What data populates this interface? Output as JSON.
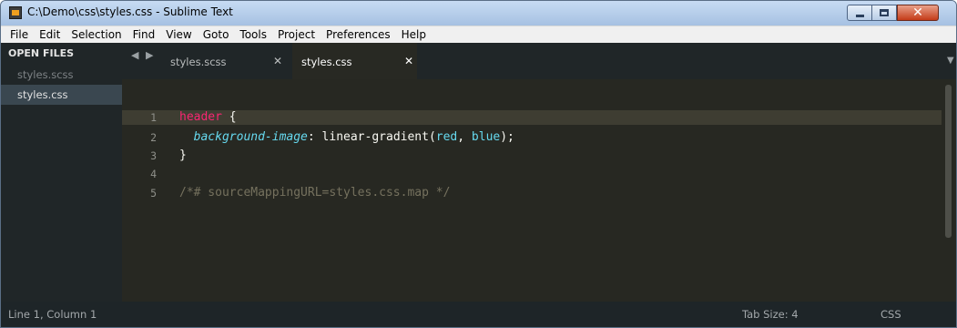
{
  "window": {
    "title": "C:\\Demo\\css\\styles.css - Sublime Text",
    "icons": {
      "app": "sublime-text-icon",
      "minimize": "minimize-icon",
      "maximize": "maximize-icon",
      "close": "close-icon"
    },
    "close_glyph": "✕"
  },
  "menu": {
    "items": [
      "File",
      "Edit",
      "Selection",
      "Find",
      "View",
      "Goto",
      "Tools",
      "Project",
      "Preferences",
      "Help"
    ]
  },
  "sidebar": {
    "heading": "OPEN FILES",
    "files": [
      "styles.scss",
      "styles.css"
    ],
    "selected": "styles.css"
  },
  "tabs": {
    "nav_arrows": "◀ ▶",
    "items": [
      {
        "label": "styles.scss",
        "close": "✕"
      },
      {
        "label": "styles.css",
        "close": "✕"
      }
    ],
    "active": "styles.css",
    "overflow_glyph": "▼"
  },
  "editor": {
    "line_numbers": [
      "1",
      "2",
      "3",
      "4",
      "5"
    ],
    "lines": {
      "l1_selector": "header",
      "l1_brace": " {",
      "l2_indent": "  ",
      "l2_property": "background-image",
      "l2_colon": ": ",
      "l2_func": "linear-gradient(",
      "l2_arg1": "red",
      "l2_sep": ", ",
      "l2_arg2": "blue",
      "l2_end": ");",
      "l3_brace": "}",
      "l5_comment": "/*# sourceMappingURL=styles.css.map */"
    },
    "active_line": 1,
    "colors": {
      "background": "#272822",
      "tag": "#f92672",
      "property": "#66d9ef",
      "comment": "#75715e",
      "text": "#f8f8f2"
    }
  },
  "statusbar": {
    "position": "Line 1, Column 1",
    "tab_size": "Tab Size: 4",
    "syntax": "CSS"
  }
}
